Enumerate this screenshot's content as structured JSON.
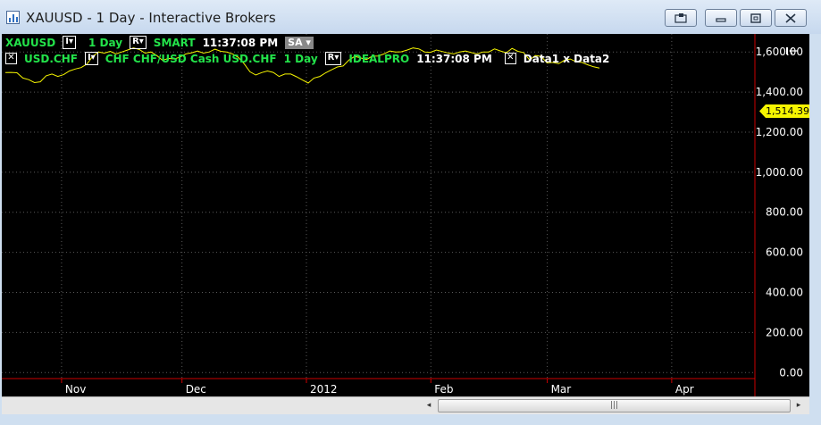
{
  "window": {
    "title": "XAUUSD - 1 Day - Interactive Brokers",
    "buttons": {
      "pin_icon": "screen-pin-icon",
      "minimize_icon": "minimize-icon",
      "maximize_icon": "maximize-icon",
      "close_icon": "close-icon"
    }
  },
  "header": {
    "row1": {
      "symbol": "XAUUSD",
      "indicator_box": "I▾",
      "interval": "1 Day",
      "range_box": "R▾",
      "exchange": "SMART",
      "time": "11:37:08 PM",
      "sa_box": "SA ▾"
    },
    "row2": {
      "close_box": "✕",
      "symbol": "USD.CHF",
      "indicator_box": "I▾",
      "description": "CHF CHF/USD Cash USD.CHF",
      "interval": "1 Day",
      "range_box": "R▾",
      "exchange": "IDEALPRO",
      "time": "11:37:08 PM",
      "close_box2": "✕",
      "study": "Data1 x Data2"
    },
    "collapse_icon": "collapse-panel-icon"
  },
  "chart_data": {
    "type": "line",
    "series": [
      {
        "values": [
          1497,
          1498,
          1496,
          1470,
          1462,
          1447,
          1451,
          1481,
          1490,
          1478,
          1487,
          1505,
          1515,
          1522,
          1540,
          1578,
          1600,
          1594,
          1603,
          1590,
          1600,
          1610,
          1620,
          1612,
          1594,
          1600,
          1582,
          1558,
          1568,
          1565,
          1575,
          1590,
          1596,
          1605,
          1594,
          1600,
          1614,
          1603,
          1600,
          1590,
          1573,
          1541,
          1501,
          1485,
          1497,
          1505,
          1498,
          1478,
          1490,
          1490,
          1476,
          1460,
          1445,
          1470,
          1478,
          1496,
          1511,
          1525,
          1530,
          1560,
          1578,
          1570,
          1562,
          1579,
          1580,
          1590,
          1605,
          1600,
          1601,
          1610,
          1620,
          1615,
          1600,
          1598,
          1610,
          1602,
          1595,
          1590,
          1600,
          1605,
          1597,
          1590,
          1600,
          1600,
          1615,
          1605,
          1596,
          1618,
          1603,
          1597,
          1560,
          1582,
          1578,
          1545,
          1548,
          1541,
          1559,
          1565,
          1551,
          1548,
          1536,
          1526,
          1520
        ]
      }
    ],
    "x_date_range": [
      "2011-10-18",
      "2012-03-14"
    ],
    "x_ticks": [
      {
        "label": "Nov",
        "date": "2011-11-01"
      },
      {
        "label": "Dec",
        "date": "2011-12-01"
      },
      {
        "label": "2012",
        "date": "2012-01-01"
      },
      {
        "label": "Feb",
        "date": "2012-02-01"
      },
      {
        "label": "Mar",
        "date": "2012-03-01"
      },
      {
        "label": "Apr",
        "date": "2012-04-01"
      }
    ],
    "y_ticks": [
      "1,600.00",
      "1,400.00",
      "1,200.00",
      "1,000.00",
      "800.00",
      "600.00",
      "400.00",
      "200.00",
      "0.00"
    ],
    "ylim": [
      -30,
      1690
    ],
    "last_price": "1,514.39",
    "colors": {
      "background": "#000000",
      "line": "#f6f500",
      "grid": "#5a5a5a",
      "axis": "#cc0000",
      "text": "#ffffff"
    },
    "grid": true
  },
  "scrollbar": {
    "grip_label": "|||",
    "left_arrow": "◂",
    "right_arrow": "▸"
  }
}
